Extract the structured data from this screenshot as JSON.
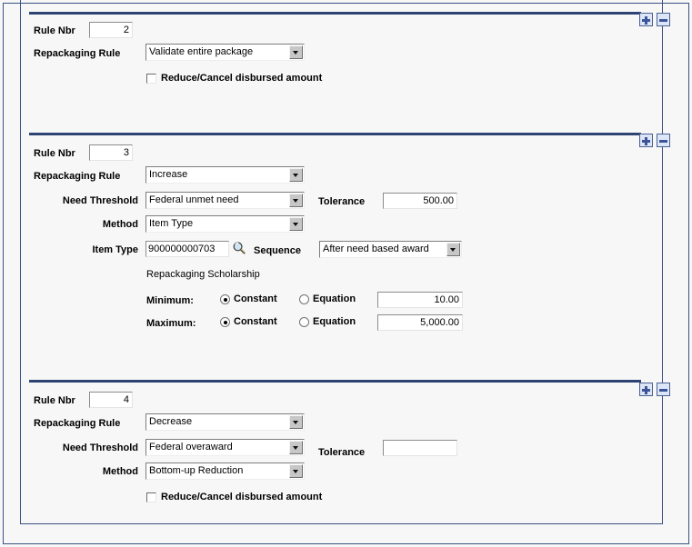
{
  "panel": {
    "accent_color": "#2d4372",
    "frame_color": "#3b5185",
    "button_face": "#dce6f7",
    "background": "#f7f7f7"
  },
  "row_controls": {
    "add_label": "+",
    "delete_label": "-",
    "add_name": "add-row-button",
    "delete_name": "delete-row-button"
  },
  "labels": {
    "rule_nbr": "Rule Nbr",
    "repackaging_rule": "Repackaging Rule",
    "need_threshold": "Need Threshold",
    "method": "Method",
    "item_type": "Item Type",
    "sequence": "Sequence",
    "tolerance": "Tolerance",
    "repackaging_scholarship": "Repackaging Scholarship",
    "minimum": "Minimum:",
    "maximum": "Maximum:",
    "constant": "Constant",
    "equation": "Equation",
    "reduce_cancel": "Reduce/Cancel disbursed amount"
  },
  "rules": [
    {
      "rule_nbr": "2",
      "repackaging_rule": "Validate entire package",
      "reduce_cancel_checked": false
    },
    {
      "rule_nbr": "3",
      "repackaging_rule": "Increase",
      "need_threshold": "Federal unmet need",
      "tolerance": "500.00",
      "method": "Item Type",
      "item_type": "900000000703",
      "sequence": "After need based award",
      "scholarship": {
        "minimum": {
          "mode": "Constant",
          "value": "10.00"
        },
        "maximum": {
          "mode": "Constant",
          "value": "5,000.00"
        }
      }
    },
    {
      "rule_nbr": "4",
      "repackaging_rule": "Decrease",
      "need_threshold": "Federal overaward",
      "tolerance": "",
      "method": "Bottom-up Reduction",
      "reduce_cancel_checked": false
    }
  ]
}
